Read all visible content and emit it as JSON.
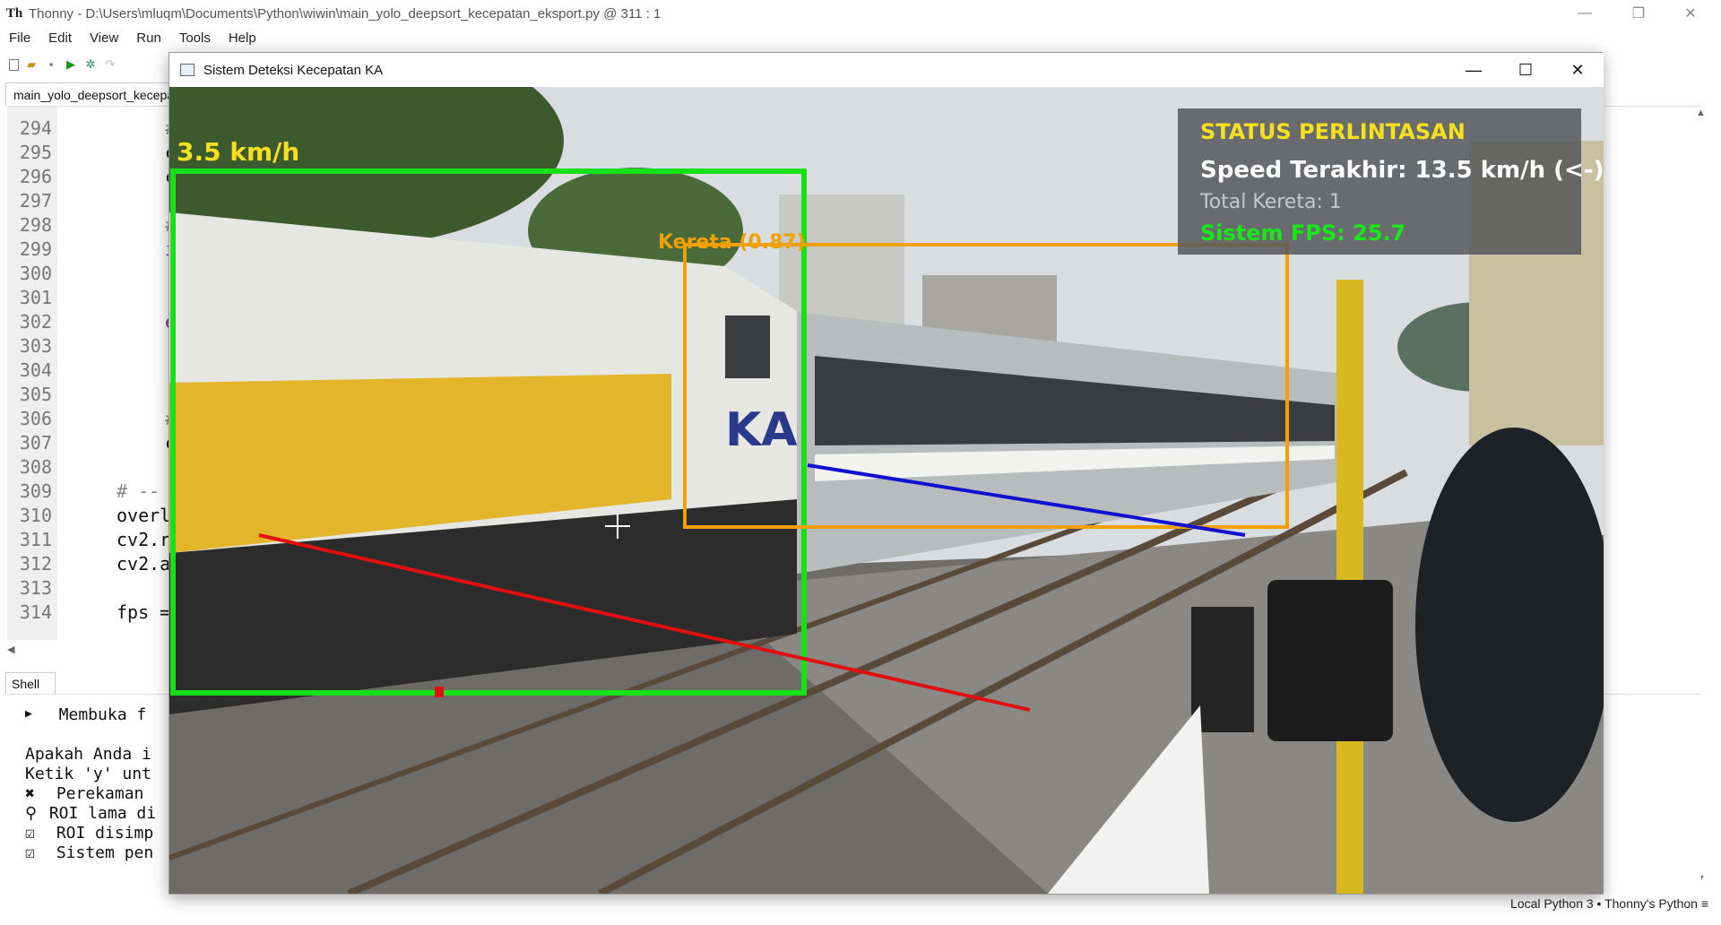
{
  "thonny": {
    "title": "Thonny  -  D:\\Users\\mluqm\\Documents\\Python\\wiwin\\main_yolo_deepsort_kecepatan_eksport.py  @  311 : 1",
    "menu": [
      "File",
      "Edit",
      "View",
      "Run",
      "Tools",
      "Help"
    ],
    "editor_tab": "main_yolo_deepsort_kecepatan_eksport.py",
    "line_numbers": [
      "294",
      "295",
      "296",
      "297",
      "298",
      "299",
      "300",
      "301",
      "302",
      "303",
      "304",
      "305",
      "306",
      "307",
      "308",
      "309",
      "310",
      "311",
      "312",
      "313",
      "314"
    ],
    "code_lines": [
      "#",
      "c",
      "c",
      "",
      "#",
      "i",
      "",
      "",
      "e",
      "",
      "",
      "",
      "#",
      "c",
      "",
      "# --",
      "overl",
      "cv2.r",
      "cv2.a",
      "",
      "fps ="
    ],
    "shell_tab": "Shell",
    "shell_lines": [
      {
        "glyph": "▶",
        "text": "  Membuka f"
      },
      {
        "glyph": "",
        "text": "Apakah Anda i"
      },
      {
        "glyph": "",
        "text": "Ketik 'y' unt"
      },
      {
        "glyph": "✖",
        "text": " Perekaman "
      },
      {
        "glyph": "⚲",
        "text": " ROI lama di"
      },
      {
        "glyph": "☑",
        "text": " ROI disimp"
      },
      {
        "glyph": "☑",
        "text": " Sistem pen"
      }
    ],
    "status": "Local Python 3  •  Thonny's Python  ≡"
  },
  "cv_window": {
    "title": "Sistem Deteksi Kecepatan KA",
    "overlay": {
      "speed_label": "3.5 km/h",
      "detection_label": "Kereta (0.87)",
      "status_title": "STATUS PERLINTASAN",
      "last_speed": "Speed Terakhir: 13.5 km/h (<-)",
      "total_trains": "Total Kereta: 1",
      "fps": "Sistem FPS: 25.7"
    }
  },
  "colors": {
    "box_green": "#16e016",
    "box_orange": "#f0a000",
    "line_red": "#e01010",
    "line_blue": "#1010d0",
    "status_yellow": "#f5e020",
    "status_green": "#18e818"
  }
}
